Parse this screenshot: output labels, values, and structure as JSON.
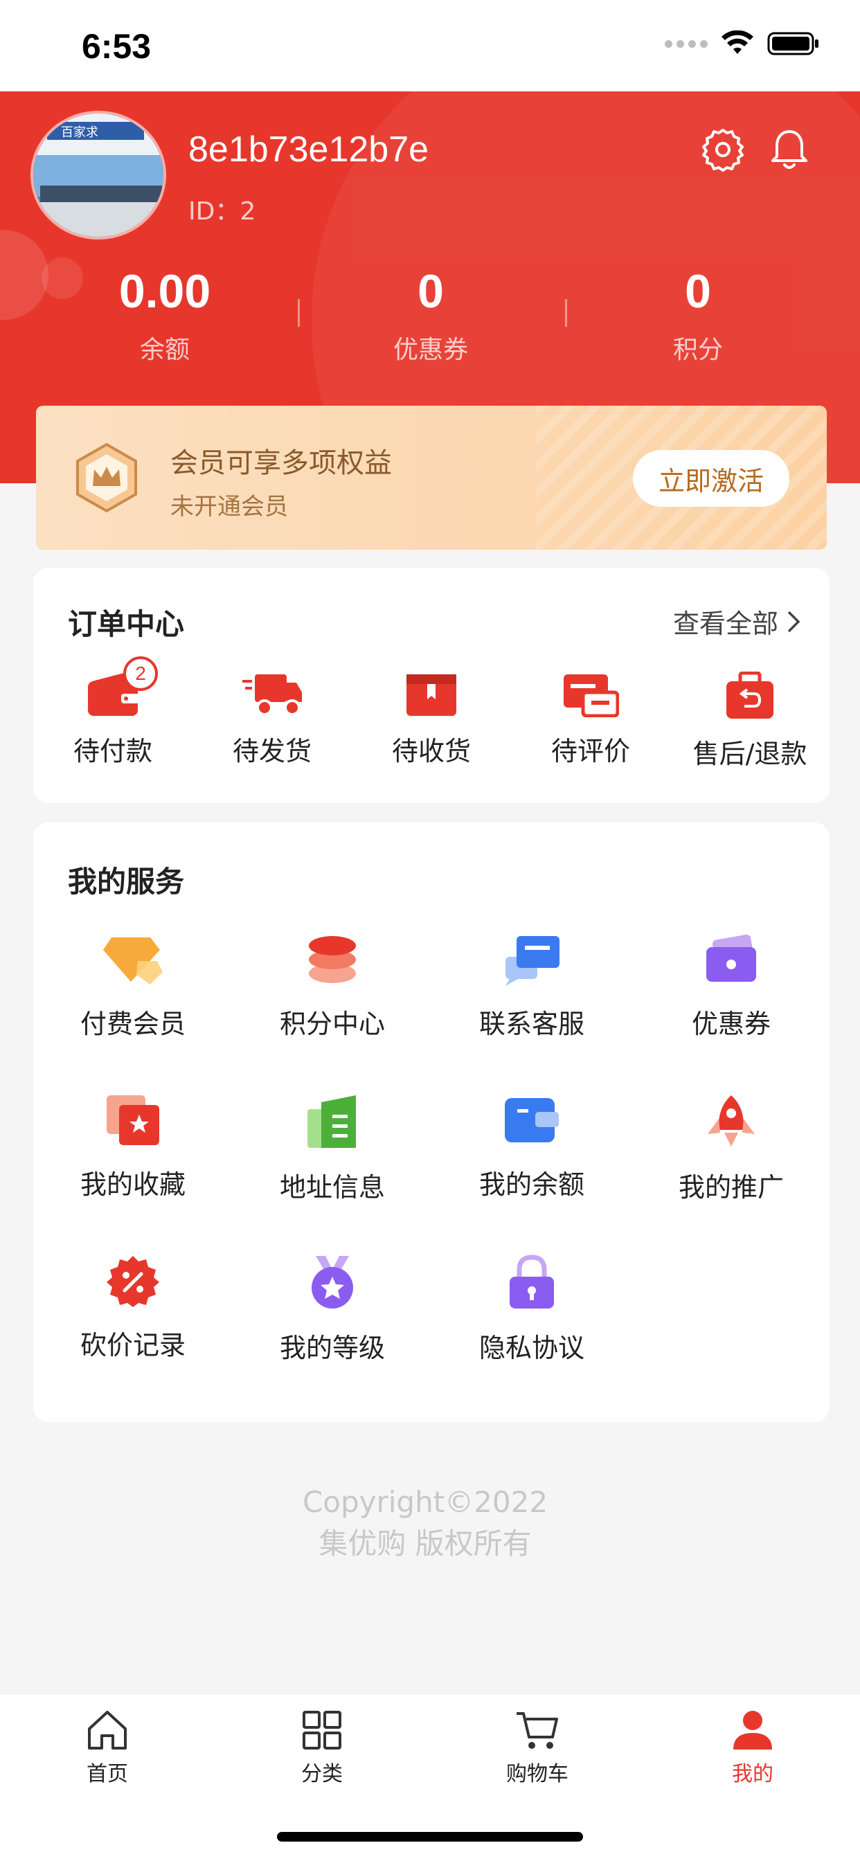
{
  "status_bar": {
    "time": "6:53"
  },
  "profile": {
    "username": "8e1b73e12b7e",
    "id_text": "ID：2",
    "avatar_text": "百家求"
  },
  "stats": [
    {
      "value": "0.00",
      "label": "余额"
    },
    {
      "value": "0",
      "label": "优惠券"
    },
    {
      "value": "0",
      "label": "积分"
    }
  ],
  "member": {
    "title": "会员可享多项权益",
    "subtitle": "未开通会员",
    "button": "立即激活"
  },
  "orders": {
    "title": "订单中心",
    "view_all": "查看全部",
    "items": [
      {
        "label": "待付款",
        "icon": "wallet-icon",
        "badge": "2"
      },
      {
        "label": "待发货",
        "icon": "truck-icon"
      },
      {
        "label": "待收货",
        "icon": "box-icon"
      },
      {
        "label": "待评价",
        "icon": "comment-icon"
      },
      {
        "label": "售后/退款",
        "icon": "return-bag-icon"
      }
    ]
  },
  "services": {
    "title": "我的服务",
    "items": [
      {
        "label": "付费会员",
        "icon": "diamond-icon"
      },
      {
        "label": "积分中心",
        "icon": "coin-stack-icon"
      },
      {
        "label": "联系客服",
        "icon": "chat-icon"
      },
      {
        "label": "优惠券",
        "icon": "coupon-icon"
      },
      {
        "label": "我的收藏",
        "icon": "favorite-icon"
      },
      {
        "label": "地址信息",
        "icon": "address-book-icon"
      },
      {
        "label": "我的余额",
        "icon": "balance-wallet-icon"
      },
      {
        "label": "我的推广",
        "icon": "rocket-icon"
      },
      {
        "label": "砍价记录",
        "icon": "discount-icon"
      },
      {
        "label": "我的等级",
        "icon": "medal-icon"
      },
      {
        "label": "隐私协议",
        "icon": "lock-icon"
      }
    ]
  },
  "footer": {
    "copyright_line1": "Copyright©2022",
    "copyright_line2": "集优购 版权所有"
  },
  "tabbar": [
    {
      "label": "首页",
      "icon": "home-icon"
    },
    {
      "label": "分类",
      "icon": "category-grid-icon"
    },
    {
      "label": "购物车",
      "icon": "cart-icon"
    },
    {
      "label": "我的",
      "icon": "user-icon",
      "active": true
    }
  ],
  "colors": {
    "brand_red": "#e7372c",
    "member_gold": "#fcd2a4",
    "active_tab": "#e7372c"
  }
}
